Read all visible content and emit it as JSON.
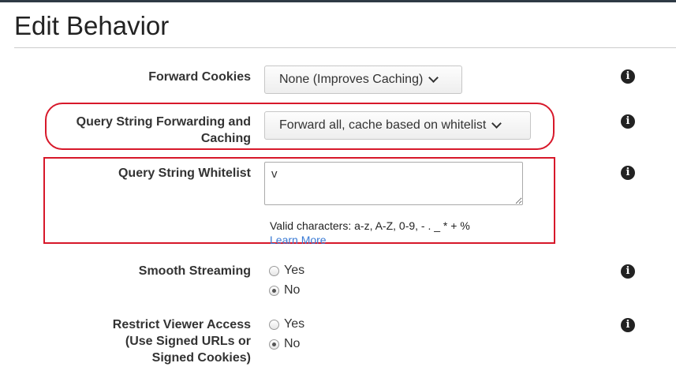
{
  "page": {
    "title": "Edit Behavior"
  },
  "fields": {
    "forward_cookies": {
      "label": "Forward Cookies",
      "value": "None (Improves Caching)"
    },
    "query_string_forwarding": {
      "label_line1": "Query String Forwarding and",
      "label_line2": "Caching",
      "value": "Forward all, cache based on whitelist"
    },
    "query_string_whitelist": {
      "label": "Query String Whitelist",
      "value": "v",
      "helper": "Valid characters: a-z, A-Z, 0-9, - . _ * + %",
      "learn_more": "Learn More"
    },
    "smooth_streaming": {
      "label": "Smooth Streaming",
      "options": [
        "Yes",
        "No"
      ],
      "selected": "No"
    },
    "restrict_viewer_access": {
      "label_line1": "Restrict Viewer Access",
      "label_line2": "(Use Signed URLs or",
      "label_line3": "Signed Cookies)",
      "options": [
        "Yes",
        "No"
      ],
      "selected": "No"
    }
  },
  "icons": {
    "info": "info-icon",
    "info_glyph": "i",
    "chevron": "chevron-down-icon"
  },
  "colors": {
    "highlight": "#d7182a",
    "link": "#3a7bd5",
    "top_bar": "#2f3a45"
  }
}
